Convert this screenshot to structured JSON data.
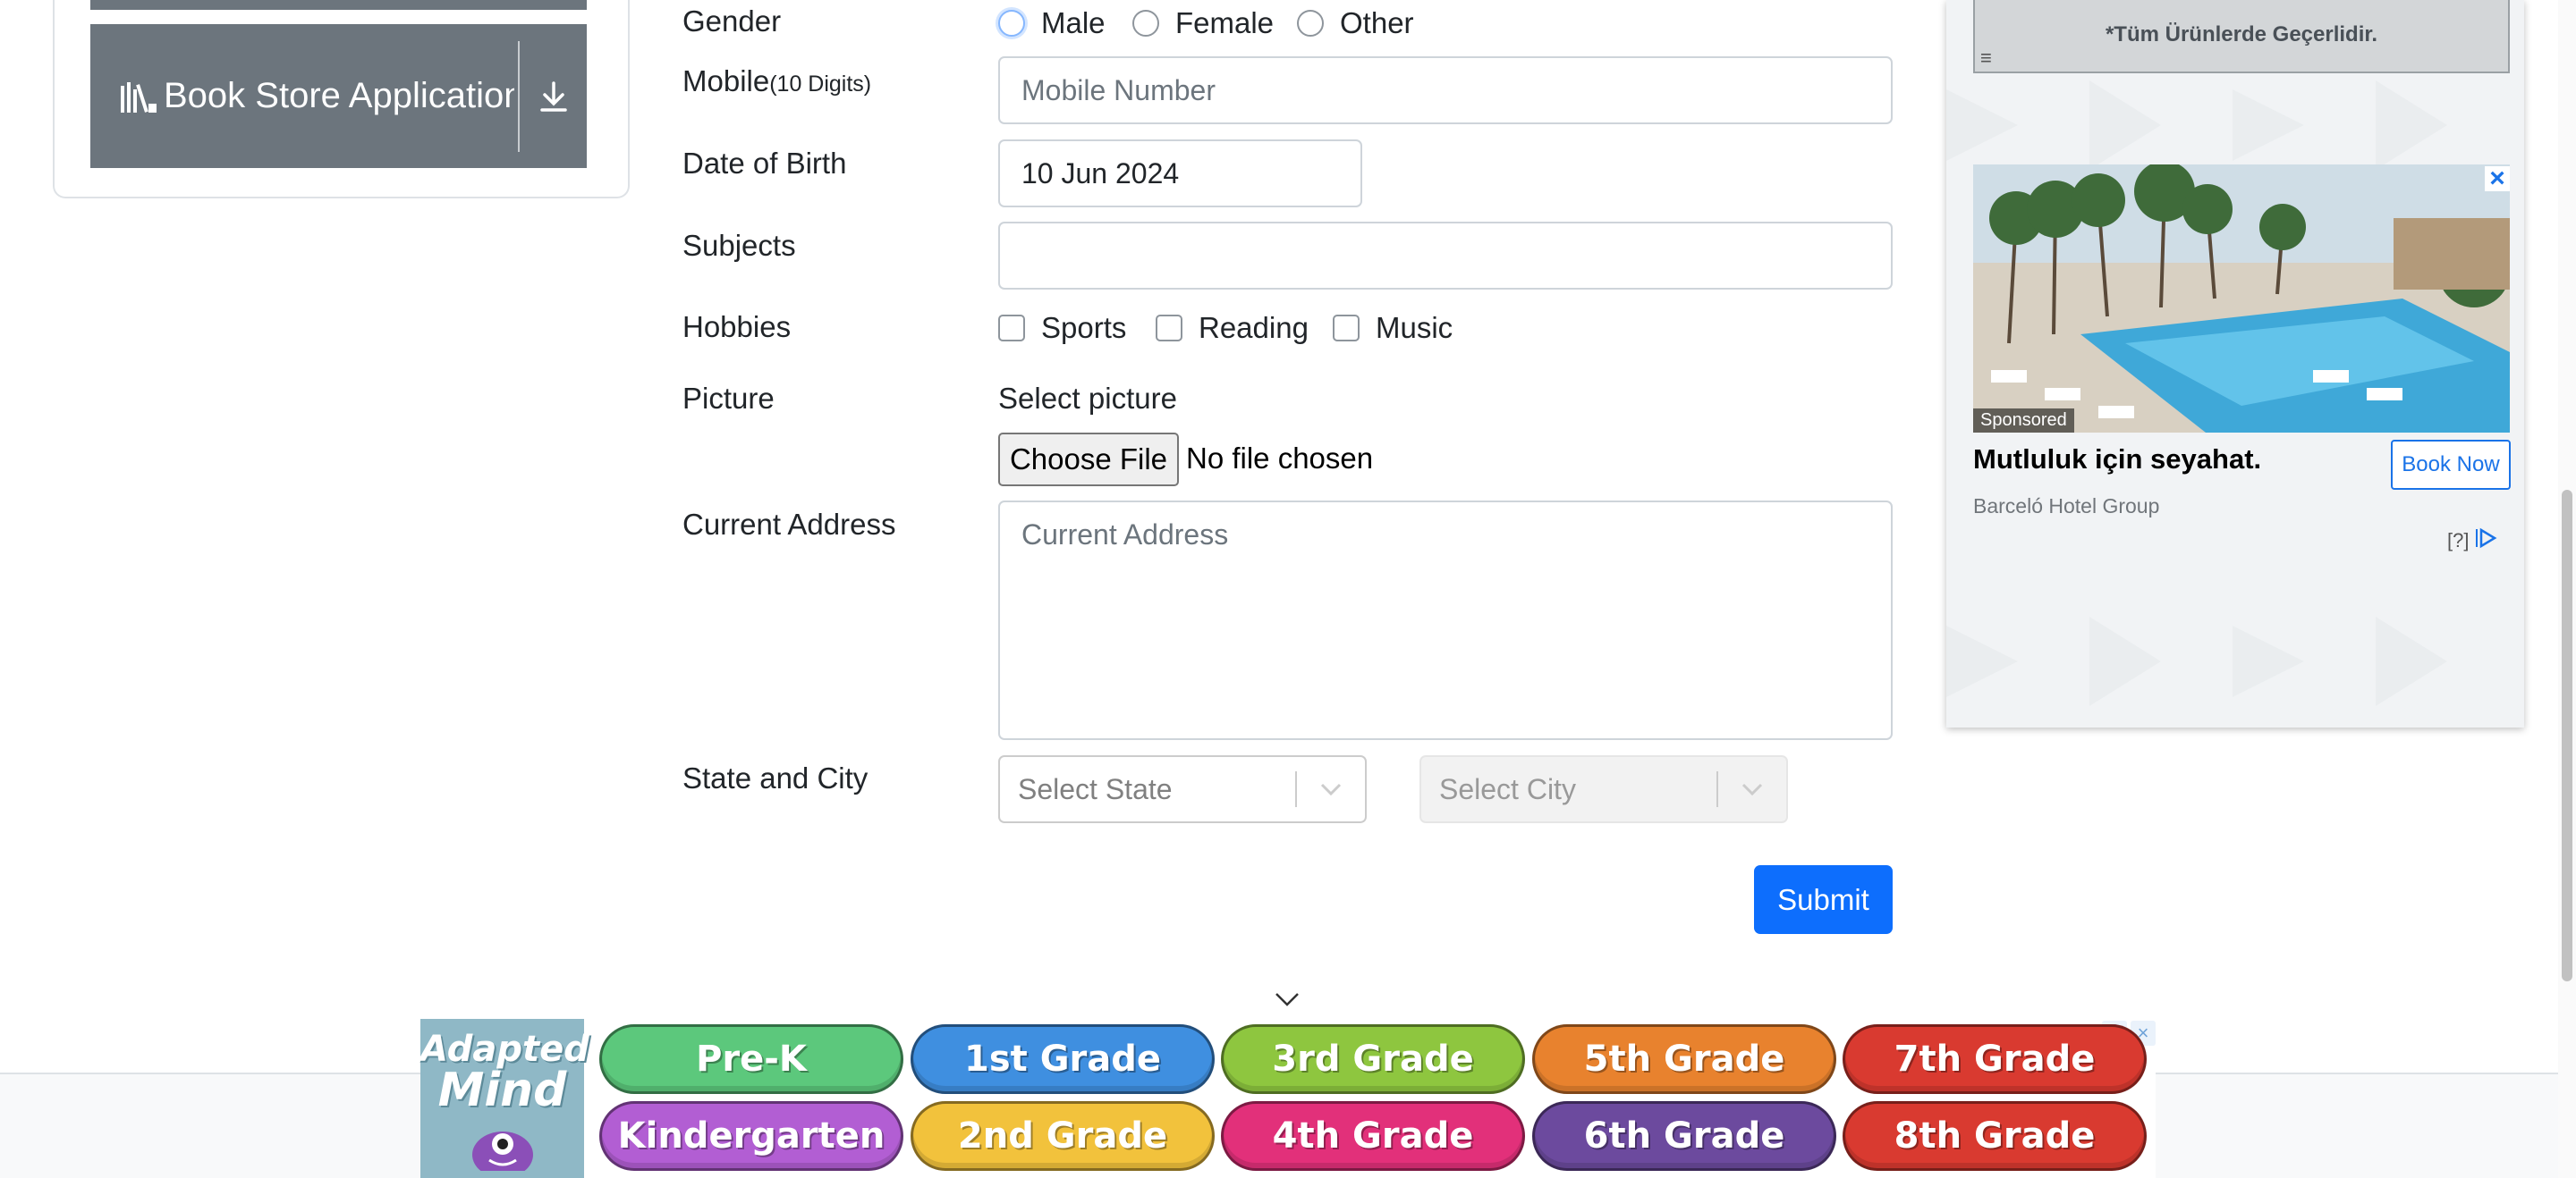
{
  "sidebar": {
    "book_store_label": "Book Store Application"
  },
  "form": {
    "gender": {
      "label": "Gender",
      "options": [
        "Male",
        "Female",
        "Other"
      ]
    },
    "mobile": {
      "label": "Mobile",
      "hint": "(10 Digits)",
      "placeholder": "Mobile Number"
    },
    "dob": {
      "label": "Date of Birth",
      "value": "10 Jun 2024"
    },
    "subjects": {
      "label": "Subjects",
      "value": ""
    },
    "hobbies": {
      "label": "Hobbies",
      "options": [
        "Sports",
        "Reading",
        "Music"
      ]
    },
    "picture": {
      "label": "Picture",
      "caption": "Select picture",
      "button": "Choose File",
      "status": "No file chosen"
    },
    "address": {
      "label": "Current Address",
      "placeholder": "Current Address"
    },
    "state_city": {
      "label": "State and City",
      "state_placeholder": "Select State",
      "city_placeholder": "Select City"
    },
    "submit": "Submit"
  },
  "right_ad": {
    "coupon_text": "*Tüm Ürünlerde Geçerlidir.",
    "sponsored": "Sponsored",
    "title": "Mutluluk için seyahat.",
    "advertiser": "Barceló Hotel Group",
    "cta": "Book Now",
    "adchoices": "[?]"
  },
  "banner_ad": {
    "brand_line1": "Adapted",
    "brand_line2": "Mind",
    "grades": [
      "Pre-K",
      "1st Grade",
      "3rd Grade",
      "5th Grade",
      "7th Grade",
      "Kindergarten",
      "2nd Grade",
      "4th Grade",
      "6th Grade",
      "8th Grade"
    ],
    "grade_colors": [
      "#5cc87c",
      "#3f8fe0",
      "#8ec63f",
      "#e8822e",
      "#d93a30",
      "#b25ed3",
      "#f2c23c",
      "#e2307a",
      "#6c4a9e",
      "#d93a30"
    ]
  },
  "colors": {
    "primary": "#0d6efd",
    "sidebar_button": "#6c757d"
  }
}
